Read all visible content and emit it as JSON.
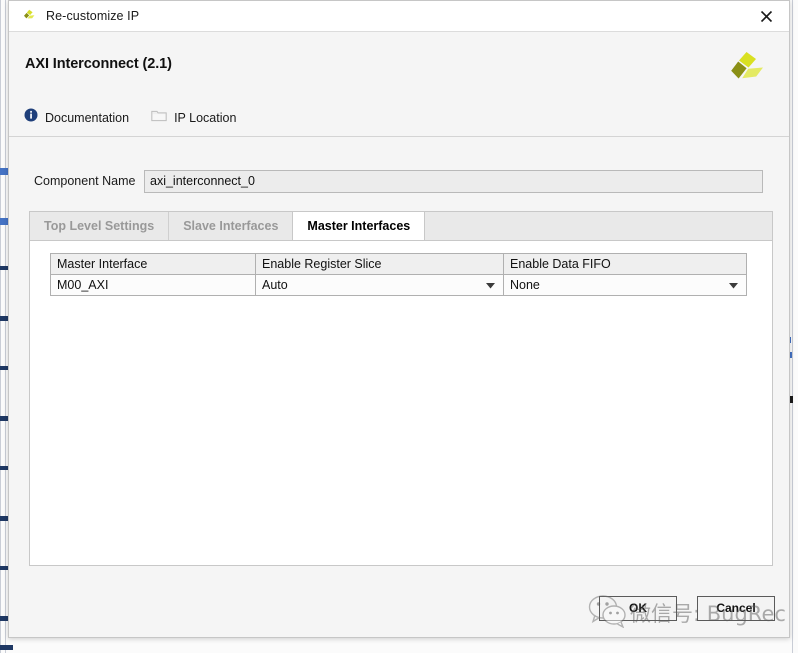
{
  "window": {
    "title": "Re-customize IP",
    "logo_icon": "vivado-pinwheel-icon",
    "close_icon": "close-icon"
  },
  "header": {
    "ip_title": "AXI Interconnect (2.1)",
    "brand_logo_icon": "xilinx-pinwheel-logo",
    "links": [
      {
        "label": "Documentation",
        "icon": "info-icon"
      },
      {
        "label": "IP Location",
        "icon": "folder-icon"
      }
    ]
  },
  "component": {
    "label": "Component Name",
    "value": "axi_interconnect_0",
    "placeholder": "axi_interconnect_0"
  },
  "tabs": [
    {
      "label": "Top Level Settings",
      "active": false
    },
    {
      "label": "Slave Interfaces",
      "active": false
    },
    {
      "label": "Master Interfaces",
      "active": true
    }
  ],
  "table": {
    "columns": [
      "Master Interface",
      "Enable Register Slice",
      "Enable Data FIFO"
    ],
    "rows": [
      {
        "master_interface": "M00_AXI",
        "enable_register_slice": "Auto",
        "enable_data_fifo": "None"
      }
    ]
  },
  "buttons": {
    "ok": "OK",
    "cancel": "Cancel"
  },
  "watermark": {
    "text": "微信号: BugRec",
    "icon": "wechat-icon"
  },
  "colors": {
    "dialog_bg": "#f5f5f5",
    "panel_bg": "#ffffff",
    "header_bg": "#efefef",
    "border": "#c8c8c8",
    "accent_info": "#1f3f7a",
    "brand_yellow": "#d6de2a",
    "brand_olive": "#8a8f15",
    "text": "#111111",
    "text_muted": "#999999"
  }
}
